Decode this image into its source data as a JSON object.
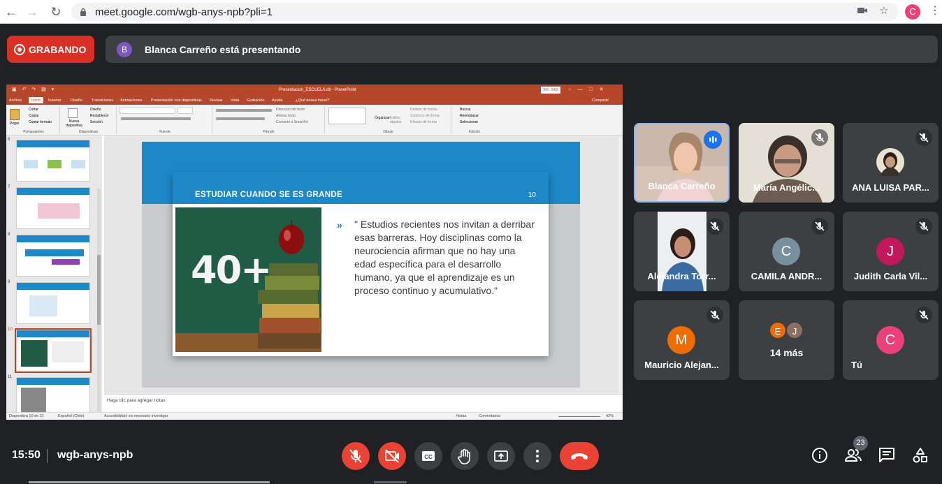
{
  "browser": {
    "url": "meet.google.com/wgb-anys-npb?pli=1",
    "profile_initial": "C",
    "profile_color": "#ec407a"
  },
  "banner": {
    "recording_label": "GRABANDO",
    "presenter_initial": "B",
    "presenting_text": "Blanca Carreño está presentando"
  },
  "powerpoint": {
    "window_title": "Presentacion_ESCUELA.db - PowerPoint",
    "account_label": "INC. SAS",
    "share_label": "Compartir",
    "tabs": [
      "Archivo",
      "Inicio",
      "Insertar",
      "Diseño",
      "Transiciones",
      "Animaciones",
      "Presentación con diapositivas",
      "Revisar",
      "Vista",
      "Grabación",
      "Ayuda",
      "¿Qué desea hacer?"
    ],
    "ribbon": {
      "clipboard": {
        "paste": "Pegar",
        "cut": "Cortar",
        "copy": "Copiar",
        "format_painter": "Copiar formato",
        "label": "Portapapeles"
      },
      "slides": {
        "new_slide": "Nueva diapositiva",
        "layout": "Diseño",
        "reset": "Restablecer",
        "section": "Sección",
        "label": "Diapositivas"
      },
      "font_label": "Fuente",
      "paragraph": {
        "text_direction": "Dirección del texto",
        "align_text": "Alinear texto",
        "smartart": "Convertir a SmartArt",
        "label": "Párrafo"
      },
      "drawing": {
        "arrange": "Organizar",
        "quick_styles": "Estilos rápidos",
        "fill": "Relleno de forma",
        "outline": "Contorno de forma",
        "effects": "Efectos de forma",
        "label": "Dibujo"
      },
      "editing": {
        "find": "Buscar",
        "replace": "Reemplazar",
        "select": "Seleccionar",
        "label": "Edición"
      }
    },
    "thumbnails": [
      {
        "num": "6"
      },
      {
        "num": "7"
      },
      {
        "num": "8"
      },
      {
        "num": "9"
      },
      {
        "num": "10"
      },
      {
        "num": "11"
      }
    ],
    "slide": {
      "title": "ESTUDIAR CUANDO SE ES GRANDE",
      "number": "10",
      "photo_text": "40+",
      "bullet": "»",
      "quote": "\" Estudios recientes nos invitan a derribar esas barreras. Hoy disciplinas como la neurociencia afirman que no hay una edad específica para el desarrollo humano, ya que el aprendizaje es un proceso continuo y acumulativo.\""
    },
    "notes_placeholder": "Haga clic para agregar notas",
    "status": {
      "slide_of": "Diapositiva 10 de 21",
      "language": "Español (Chile)",
      "accessibility": "Accesibilidad: es necesario investigar",
      "notes": "Notas",
      "comments": "Comentarios",
      "zoom": "42%"
    }
  },
  "participants": [
    {
      "name": "Blanca Carreño",
      "speaking": true
    },
    {
      "name": "María Angélic...",
      "muted": true
    },
    {
      "name": "ANA LUISA PAR...",
      "muted": true
    },
    {
      "name": "Alejandra Torr...",
      "muted": true
    },
    {
      "name": "CAMILA ANDR...",
      "initial": "C",
      "color": "#78909c",
      "muted": true
    },
    {
      "name": "Judith Carla Vil...",
      "initial": "J",
      "color": "#c2185b",
      "muted": true
    },
    {
      "name": "Mauricio Alejan...",
      "initial": "M",
      "color": "#ef6c00",
      "muted": true
    },
    {
      "name": "14 más",
      "initials": [
        "E",
        "J"
      ],
      "colors": [
        "#ef6c00",
        "#8d6e63"
      ]
    },
    {
      "name": "Tú",
      "initial": "C",
      "color": "#ec407a",
      "muted": true
    }
  ],
  "controls": {
    "time": "15:50",
    "meeting_code": "wgb-anys-npb",
    "participants_count": "23",
    "icons": [
      "mic-off-icon",
      "camera-off-icon",
      "captions-icon",
      "raise-hand-icon",
      "present-icon",
      "more-options-icon",
      "end-call-icon",
      "info-icon",
      "people-icon",
      "chat-icon",
      "activities-icon"
    ]
  }
}
